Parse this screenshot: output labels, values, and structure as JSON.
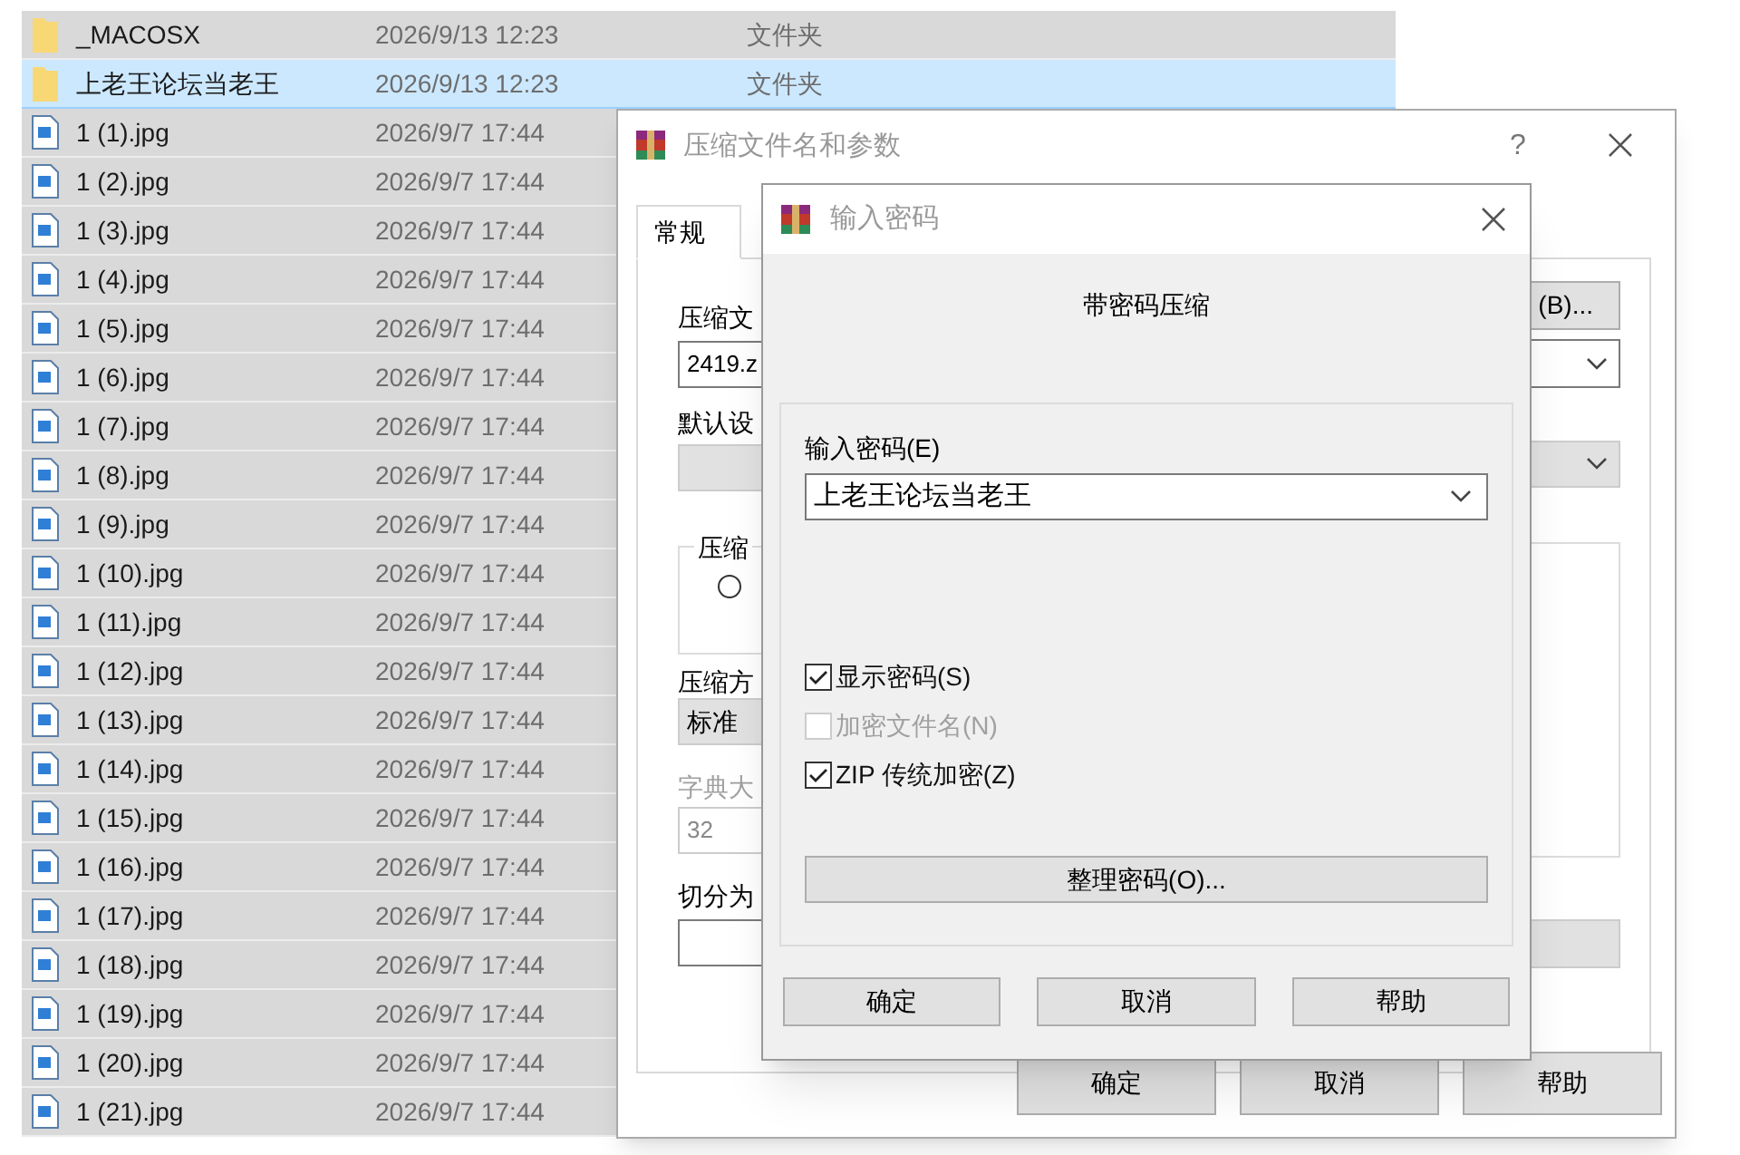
{
  "file_list": {
    "rows": [
      {
        "kind": "folder",
        "name": "_MACOSX",
        "date": "2026/9/13 12:23",
        "type": "文件夹",
        "selected": false
      },
      {
        "kind": "folder",
        "name": "上老王论坛当老王",
        "date": "2026/9/13 12:23",
        "type": "文件夹",
        "selected": true
      },
      {
        "kind": "image",
        "name": "1 (1).jpg",
        "date": "2026/9/7 17:44",
        "selected": false
      },
      {
        "kind": "image",
        "name": "1 (2).jpg",
        "date": "2026/9/7 17:44",
        "selected": false
      },
      {
        "kind": "image",
        "name": "1 (3).jpg",
        "date": "2026/9/7 17:44",
        "selected": false
      },
      {
        "kind": "image",
        "name": "1 (4).jpg",
        "date": "2026/9/7 17:44",
        "selected": false
      },
      {
        "kind": "image",
        "name": "1 (5).jpg",
        "date": "2026/9/7 17:44",
        "selected": false
      },
      {
        "kind": "image",
        "name": "1 (6).jpg",
        "date": "2026/9/7 17:44",
        "selected": false
      },
      {
        "kind": "image",
        "name": "1 (7).jpg",
        "date": "2026/9/7 17:44",
        "selected": false
      },
      {
        "kind": "image",
        "name": "1 (8).jpg",
        "date": "2026/9/7 17:44",
        "selected": false
      },
      {
        "kind": "image",
        "name": "1 (9).jpg",
        "date": "2026/9/7 17:44",
        "selected": false
      },
      {
        "kind": "image",
        "name": "1 (10).jpg",
        "date": "2026/9/7 17:44",
        "selected": false
      },
      {
        "kind": "image",
        "name": "1 (11).jpg",
        "date": "2026/9/7 17:44",
        "selected": false
      },
      {
        "kind": "image",
        "name": "1 (12).jpg",
        "date": "2026/9/7 17:44",
        "selected": false
      },
      {
        "kind": "image",
        "name": "1 (13).jpg",
        "date": "2026/9/7 17:44",
        "selected": false
      },
      {
        "kind": "image",
        "name": "1 (14).jpg",
        "date": "2026/9/7 17:44",
        "selected": false
      },
      {
        "kind": "image",
        "name": "1 (15).jpg",
        "date": "2026/9/7 17:44",
        "selected": false
      },
      {
        "kind": "image",
        "name": "1 (16).jpg",
        "date": "2026/9/7 17:44",
        "selected": false
      },
      {
        "kind": "image",
        "name": "1 (17).jpg",
        "date": "2026/9/7 17:44",
        "selected": false
      },
      {
        "kind": "image",
        "name": "1 (18).jpg",
        "date": "2026/9/7 17:44",
        "selected": false
      },
      {
        "kind": "image",
        "name": "1 (19).jpg",
        "date": "2026/9/7 17:44",
        "selected": false
      },
      {
        "kind": "image",
        "name": "1 (20).jpg",
        "date": "2026/9/7 17:44",
        "selected": false
      },
      {
        "kind": "image",
        "name": "1 (21).jpg",
        "date": "2026/9/7 17:44",
        "selected": false
      }
    ]
  },
  "archive_dialog": {
    "title": "压缩文件名和参数",
    "help": "?",
    "tabs": [
      {
        "label": "常规",
        "selected": true
      }
    ],
    "archive_name_label": "压缩文",
    "archive_name_value": "2419.z",
    "browse_button": "(B)...",
    "profile_label": "默认设",
    "format_group_label": "压缩",
    "format_options": [
      {
        "selected": false
      }
    ],
    "method_label": "压缩方",
    "method_value": "标准",
    "dictionary_label": "字典大",
    "dictionary_value": "32",
    "split_label": "切分为",
    "buttons": [
      "确定",
      "取消",
      "帮助"
    ]
  },
  "password_dialog": {
    "title": "输入密码",
    "heading": "带密码压缩",
    "password_label": "输入密码(E)",
    "password_value": "上老王论坛当老王",
    "options": [
      {
        "label": "显示密码(S)",
        "checked": true,
        "disabled": false
      },
      {
        "label": "加密文件名(N)",
        "checked": false,
        "disabled": true
      },
      {
        "label": "ZIP 传统加密(Z)",
        "checked": true,
        "disabled": false
      }
    ],
    "organize_button": "整理密码(O)...",
    "buttons": [
      "确定",
      "取消",
      "帮助"
    ]
  }
}
